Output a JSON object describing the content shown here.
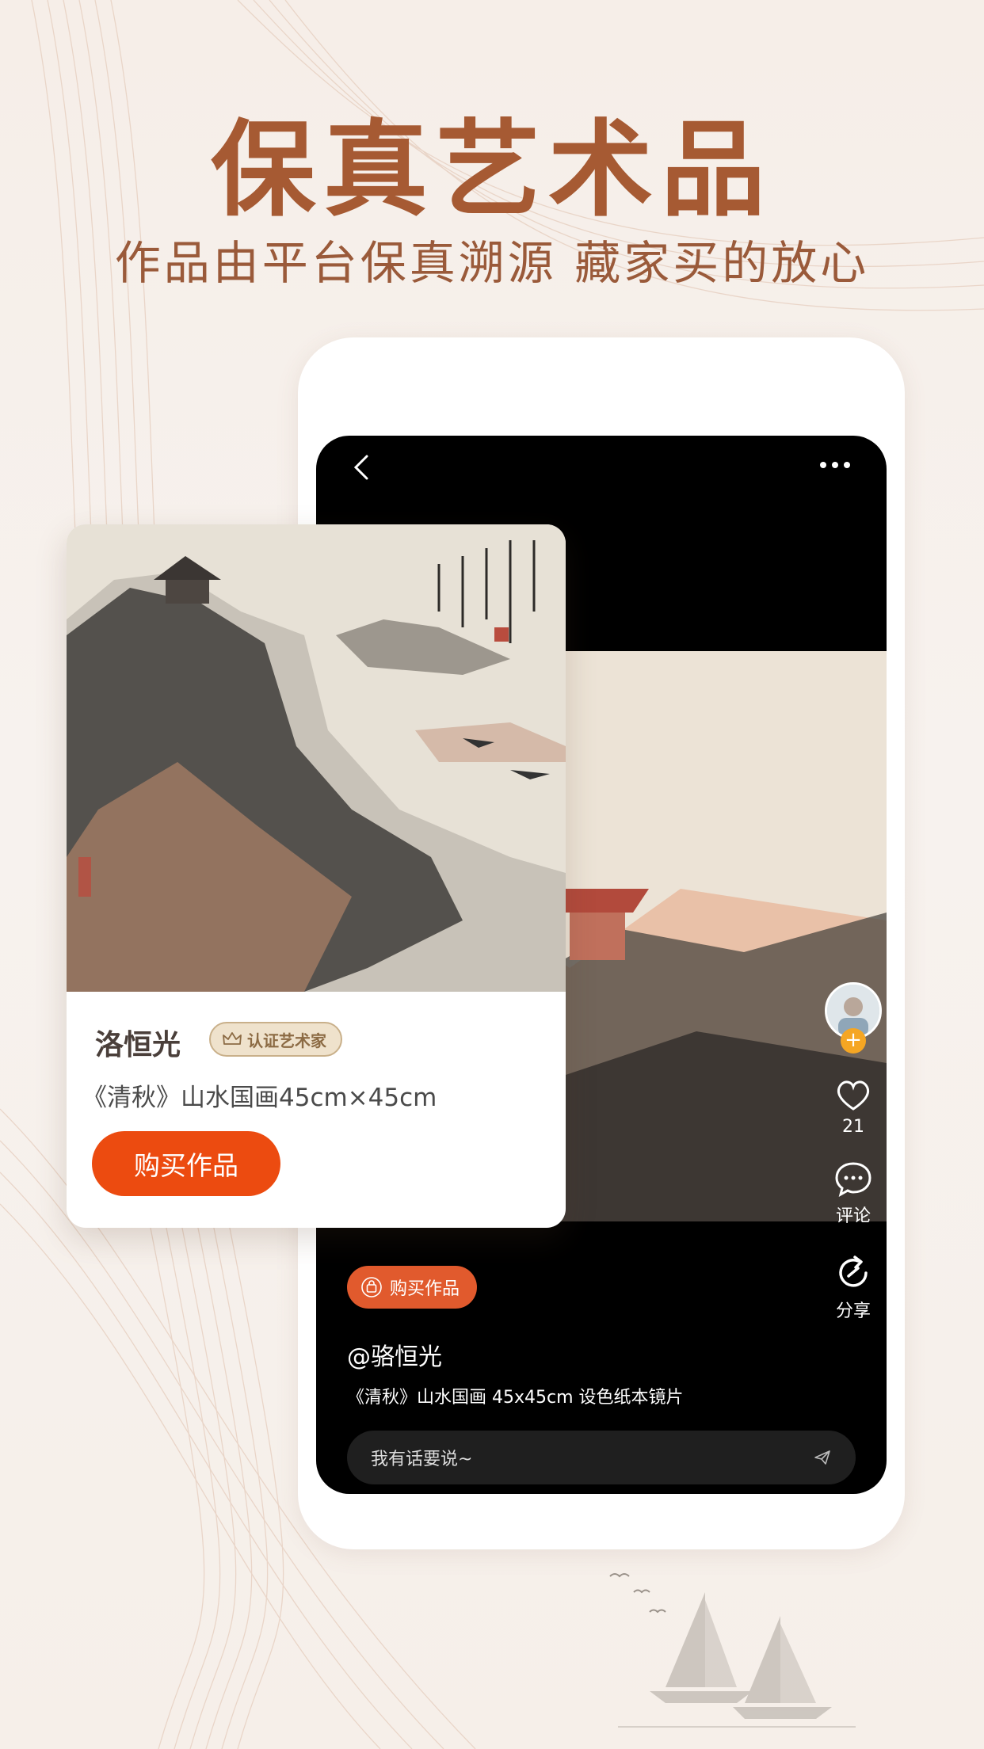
{
  "promo": {
    "headline": "保真艺术品",
    "subheadline": "作品由平台保真溯源 藏家买的放心"
  },
  "card": {
    "artist": "洛恒光",
    "badge": "认证艺术家",
    "work_title": "《清秋》山水国画45cm×45cm",
    "buy_button": "购买作品"
  },
  "player": {
    "buy_pill": "购买作品",
    "author": "@骆恒光",
    "description": "《清秋》山水国画 45x45cm 设色纸本镜片",
    "comment_placeholder": "我有话要说~",
    "like_count": "21",
    "comment_label": "评论",
    "share_label": "分享"
  },
  "colors": {
    "headline": "#a65a33",
    "buy_button": "#ec4b10",
    "buy_pill": "#e15a2d"
  },
  "icons": [
    "back-icon",
    "more-icon",
    "heart-icon",
    "comment-icon",
    "share-icon",
    "bag-icon",
    "crown-icon",
    "send-icon"
  ]
}
